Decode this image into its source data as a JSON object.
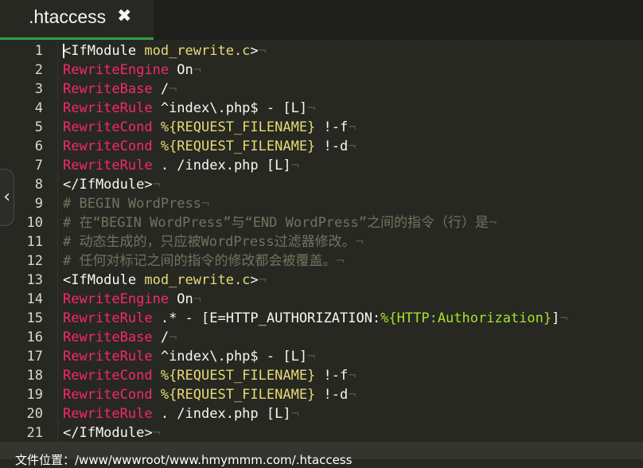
{
  "tab": {
    "title": ".htaccess",
    "close_icon": "close-icon"
  },
  "status_bar": {
    "text": "文件位置：/www/wwwroot/www.hmymmm.com/.htaccess"
  },
  "side_handle": {
    "icon": "chevron-left-icon",
    "glyph": "‹"
  },
  "editor": {
    "whitespace_marker": "¬",
    "space_marker": "·",
    "lines": [
      {
        "n": "1",
        "tokens": [
          [
            "tag",
            "<IfModule "
          ],
          [
            "attr",
            "mod_rewrite.c"
          ],
          [
            "tag",
            ">"
          ]
        ]
      },
      {
        "n": "2",
        "tokens": [
          [
            "kw",
            "RewriteEngine"
          ],
          [
            "val",
            " On"
          ]
        ]
      },
      {
        "n": "3",
        "tokens": [
          [
            "kw",
            "RewriteBase"
          ],
          [
            "val",
            " /"
          ]
        ]
      },
      {
        "n": "4",
        "tokens": [
          [
            "kw",
            "RewriteRule"
          ],
          [
            "val",
            " ^index\\.php$ - "
          ],
          [
            "flag",
            "[L]"
          ]
        ]
      },
      {
        "n": "5",
        "tokens": [
          [
            "kw",
            "RewriteCond"
          ],
          [
            "str",
            " %{REQUEST_FILENAME}"
          ],
          [
            "val",
            " !-f"
          ]
        ]
      },
      {
        "n": "6",
        "tokens": [
          [
            "kw",
            "RewriteCond"
          ],
          [
            "str",
            " %{REQUEST_FILENAME}"
          ],
          [
            "val",
            " !-d"
          ]
        ]
      },
      {
        "n": "7",
        "tokens": [
          [
            "kw",
            "RewriteRule"
          ],
          [
            "val",
            " . /index.php "
          ],
          [
            "flag",
            "[L]"
          ]
        ]
      },
      {
        "n": "8",
        "tokens": [
          [
            "tag",
            "</IfModule>"
          ]
        ]
      },
      {
        "n": "9",
        "tokens": [
          [
            "cmt",
            "# BEGIN WordPress"
          ]
        ]
      },
      {
        "n": "10",
        "tokens": [
          [
            "cmt",
            "# 在“BEGIN WordPress”与“END WordPress”之间的指令（行）是"
          ]
        ]
      },
      {
        "n": "11",
        "tokens": [
          [
            "cmt",
            "# 动态生成的，只应被WordPress过滤器修改。"
          ]
        ]
      },
      {
        "n": "12",
        "tokens": [
          [
            "cmt",
            "# 任何对标记之间的指令的修改都会被覆盖。"
          ]
        ]
      },
      {
        "n": "13",
        "tokens": [
          [
            "tag",
            "<IfModule "
          ],
          [
            "attr",
            "mod_rewrite.c"
          ],
          [
            "tag",
            ">"
          ]
        ]
      },
      {
        "n": "14",
        "tokens": [
          [
            "kw",
            "RewriteEngine"
          ],
          [
            "val",
            " On"
          ]
        ]
      },
      {
        "n": "15",
        "tokens": [
          [
            "kw",
            "RewriteRule"
          ],
          [
            "val",
            " .* - [E=HTTP_AUTHORIZATION:"
          ],
          [
            "auth",
            "%{HTTP:Authorization}"
          ],
          [
            "val",
            "]"
          ]
        ]
      },
      {
        "n": "16",
        "tokens": [
          [
            "kw",
            "RewriteBase"
          ],
          [
            "val",
            " /"
          ]
        ]
      },
      {
        "n": "17",
        "tokens": [
          [
            "kw",
            "RewriteRule"
          ],
          [
            "val",
            " ^index\\.php$ - "
          ],
          [
            "flag",
            "[L]"
          ]
        ]
      },
      {
        "n": "18",
        "tokens": [
          [
            "kw",
            "RewriteCond"
          ],
          [
            "str",
            " %{REQUEST_FILENAME}"
          ],
          [
            "val",
            " !-f"
          ]
        ]
      },
      {
        "n": "19",
        "tokens": [
          [
            "kw",
            "RewriteCond"
          ],
          [
            "str",
            " %{REQUEST_FILENAME}"
          ],
          [
            "val",
            " !-d"
          ]
        ]
      },
      {
        "n": "20",
        "tokens": [
          [
            "kw",
            "RewriteRule"
          ],
          [
            "val",
            " . /index.php "
          ],
          [
            "flag",
            "[L]"
          ]
        ]
      },
      {
        "n": "21",
        "tokens": [
          [
            "tag",
            "</IfModule>"
          ]
        ]
      }
    ]
  },
  "colors": {
    "background": "#272822",
    "keyword": "#f92672",
    "string": "#e6db74",
    "function": "#a6e22e",
    "comment": "#75715e",
    "tab_accent": "#2ea043"
  }
}
